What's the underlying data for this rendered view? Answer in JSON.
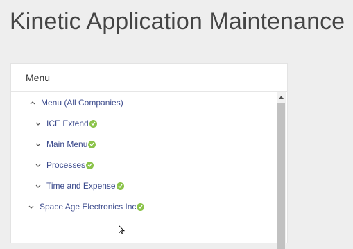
{
  "page": {
    "title": "Kinetic Application Maintenance"
  },
  "panel": {
    "header": "Menu",
    "tree": [
      {
        "label": "Menu (All Companies)",
        "expanded": true,
        "level": 0,
        "status": "none"
      },
      {
        "label": "ICE Extend",
        "expanded": false,
        "level": 1,
        "status": "valid"
      },
      {
        "label": "Main Menu",
        "expanded": false,
        "level": 1,
        "status": "valid"
      },
      {
        "label": "Processes",
        "expanded": false,
        "level": 1,
        "status": "valid"
      },
      {
        "label": "Time and Expense",
        "expanded": false,
        "level": 1,
        "status": "valid"
      },
      {
        "label": "Space Age Electronics Inc",
        "expanded": false,
        "level": 0,
        "status": "valid"
      }
    ]
  },
  "colors": {
    "link": "#3b4a8c",
    "check": "#8bc34a",
    "title": "#444444"
  }
}
